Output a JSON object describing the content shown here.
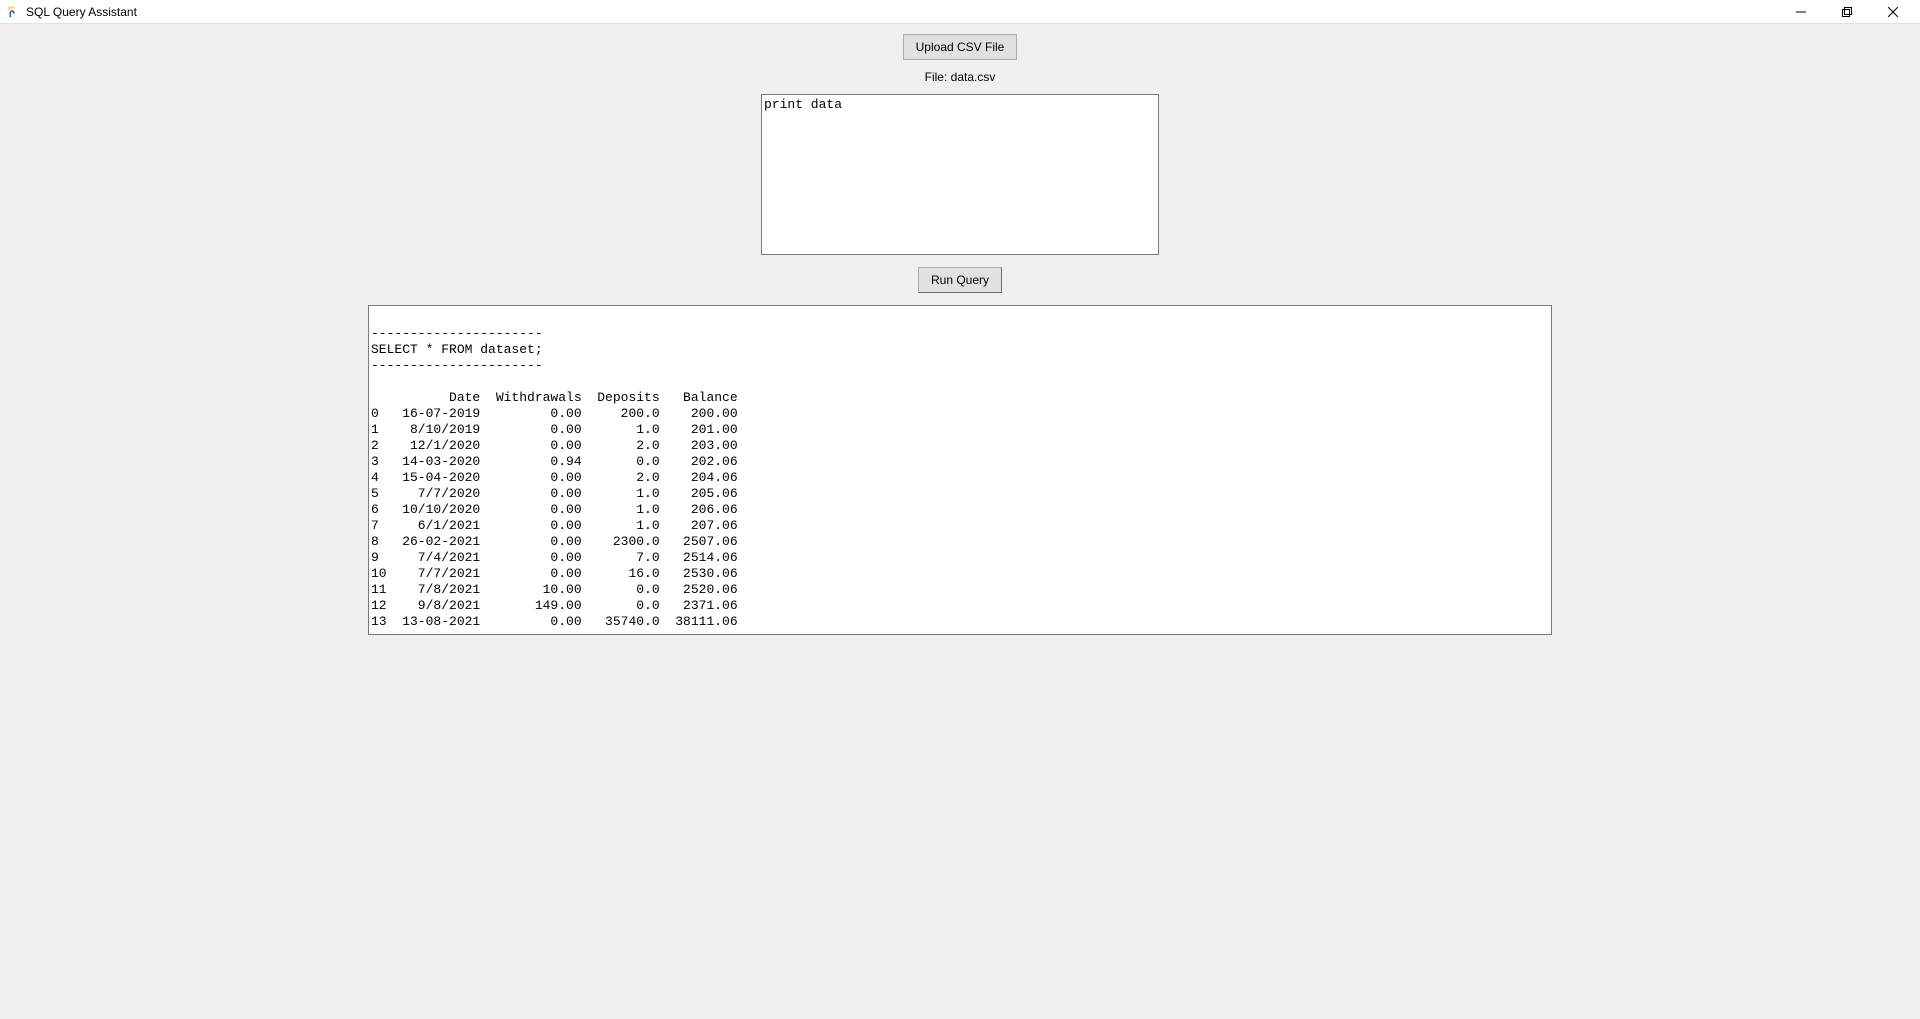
{
  "window": {
    "title": "SQL Query Assistant"
  },
  "buttons": {
    "upload": "Upload CSV File",
    "run": "Run Query"
  },
  "file_label": "File: data.csv",
  "query_input_value": "print data",
  "output": {
    "divider": "----------------------",
    "sql": "SELECT * FROM dataset;",
    "columns": [
      "",
      "Date",
      "Withdrawals",
      "Deposits",
      "Balance"
    ],
    "rows": [
      {
        "idx": "0",
        "Date": "16-07-2019",
        "Withdrawals": "0.00",
        "Deposits": "200.0",
        "Balance": "200.00"
      },
      {
        "idx": "1",
        "Date": "8/10/2019",
        "Withdrawals": "0.00",
        "Deposits": "1.0",
        "Balance": "201.00"
      },
      {
        "idx": "2",
        "Date": "12/1/2020",
        "Withdrawals": "0.00",
        "Deposits": "2.0",
        "Balance": "203.00"
      },
      {
        "idx": "3",
        "Date": "14-03-2020",
        "Withdrawals": "0.94",
        "Deposits": "0.0",
        "Balance": "202.06"
      },
      {
        "idx": "4",
        "Date": "15-04-2020",
        "Withdrawals": "0.00",
        "Deposits": "2.0",
        "Balance": "204.06"
      },
      {
        "idx": "5",
        "Date": "7/7/2020",
        "Withdrawals": "0.00",
        "Deposits": "1.0",
        "Balance": "205.06"
      },
      {
        "idx": "6",
        "Date": "10/10/2020",
        "Withdrawals": "0.00",
        "Deposits": "1.0",
        "Balance": "206.06"
      },
      {
        "idx": "7",
        "Date": "6/1/2021",
        "Withdrawals": "0.00",
        "Deposits": "1.0",
        "Balance": "207.06"
      },
      {
        "idx": "8",
        "Date": "26-02-2021",
        "Withdrawals": "0.00",
        "Deposits": "2300.0",
        "Balance": "2507.06"
      },
      {
        "idx": "9",
        "Date": "7/4/2021",
        "Withdrawals": "0.00",
        "Deposits": "7.0",
        "Balance": "2514.06"
      },
      {
        "idx": "10",
        "Date": "7/7/2021",
        "Withdrawals": "0.00",
        "Deposits": "16.0",
        "Balance": "2530.06"
      },
      {
        "idx": "11",
        "Date": "7/8/2021",
        "Withdrawals": "10.00",
        "Deposits": "0.0",
        "Balance": "2520.06"
      },
      {
        "idx": "12",
        "Date": "9/8/2021",
        "Withdrawals": "149.00",
        "Deposits": "0.0",
        "Balance": "2371.06"
      },
      {
        "idx": "13",
        "Date": "13-08-2021",
        "Withdrawals": "0.00",
        "Deposits": "35740.0",
        "Balance": "38111.06"
      }
    ]
  }
}
